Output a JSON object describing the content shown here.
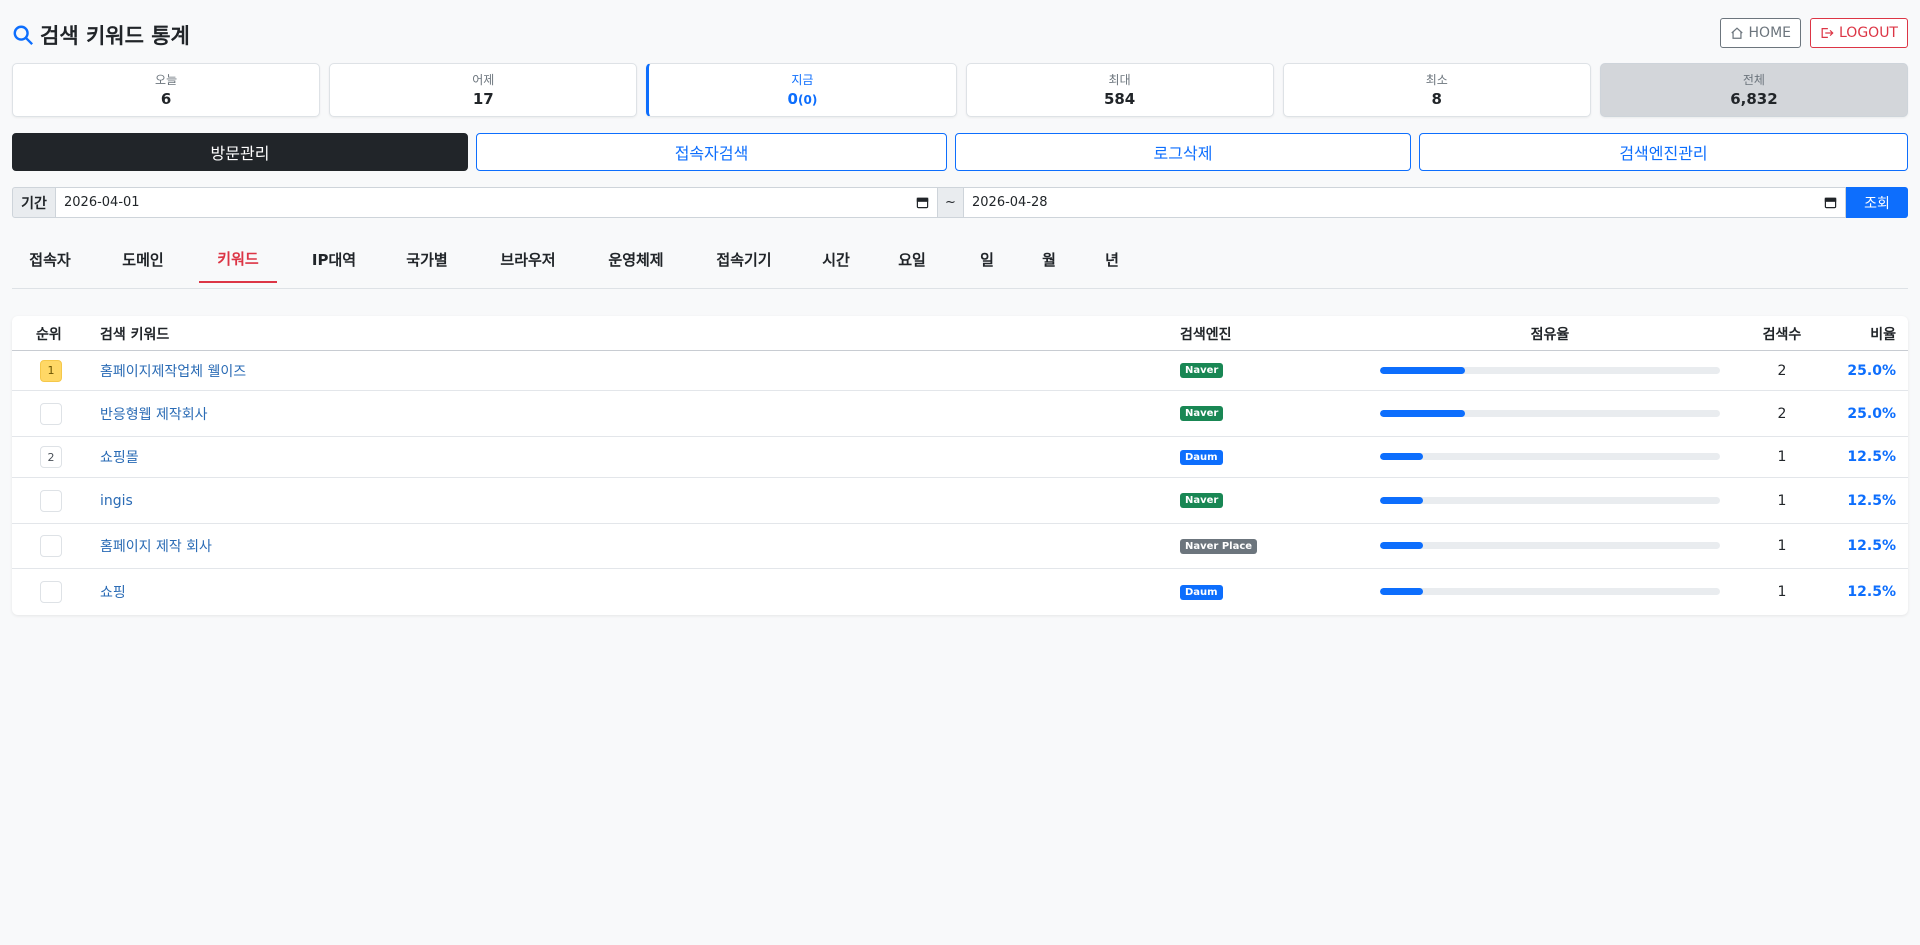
{
  "header": {
    "title": "검색 키워드 통계",
    "home_label": "HOME",
    "logout_label": "LOGOUT"
  },
  "stats": [
    {
      "label": "오늘",
      "value": "6"
    },
    {
      "label": "어제",
      "value": "17"
    },
    {
      "label": "지금",
      "value": "0",
      "sub": "(0)"
    },
    {
      "label": "최대",
      "value": "584"
    },
    {
      "label": "최소",
      "value": "8"
    },
    {
      "label": "전체",
      "value": "6,832"
    }
  ],
  "nav": [
    "방문관리",
    "접속자검색",
    "로그삭제",
    "검색엔진관리"
  ],
  "period": {
    "label": "기간",
    "start": "2026-04-01",
    "tilde": "~",
    "end": "2026-04-28",
    "submit": "조회"
  },
  "tabs": [
    "접속자",
    "도메인",
    "키워드",
    "IP대역",
    "국가별",
    "브라우저",
    "운영체제",
    "접속기기",
    "시간",
    "요일",
    "일",
    "월",
    "년"
  ],
  "table": {
    "headers": {
      "rank": "순위",
      "keyword": "검색 키워드",
      "engine": "검색엔진",
      "share": "점유율",
      "count": "검색수",
      "ratio": "비율"
    },
    "rows": [
      {
        "rank": "1",
        "keyword": "홈페이지제작업체 웰이즈",
        "engine": "Naver",
        "count": "2",
        "ratio": "25.0%",
        "share": 0.25
      },
      {
        "rank": "",
        "keyword": "반응형웹 제작회사",
        "engine": "Naver",
        "count": "2",
        "ratio": "25.0%",
        "share": 0.25
      },
      {
        "rank": "2",
        "keyword": "쇼핑몰",
        "engine": "Daum",
        "count": "1",
        "ratio": "12.5%",
        "share": 0.125
      },
      {
        "rank": "",
        "keyword": "ingis",
        "engine": "Naver",
        "count": "1",
        "ratio": "12.5%",
        "share": 0.125
      },
      {
        "rank": "",
        "keyword": "홈페이지 제작 회사",
        "engine": "Naver Place",
        "count": "1",
        "ratio": "12.5%",
        "share": 0.125
      },
      {
        "rank": "",
        "keyword": "쇼핑",
        "engine": "Daum",
        "count": "1",
        "ratio": "12.5%",
        "share": 0.125
      }
    ]
  },
  "colors": {
    "accent": "#0d6efd",
    "danger": "#dc3545",
    "naver": "#198754",
    "daum": "#0d6efd",
    "naver_place": "#6c757d"
  }
}
